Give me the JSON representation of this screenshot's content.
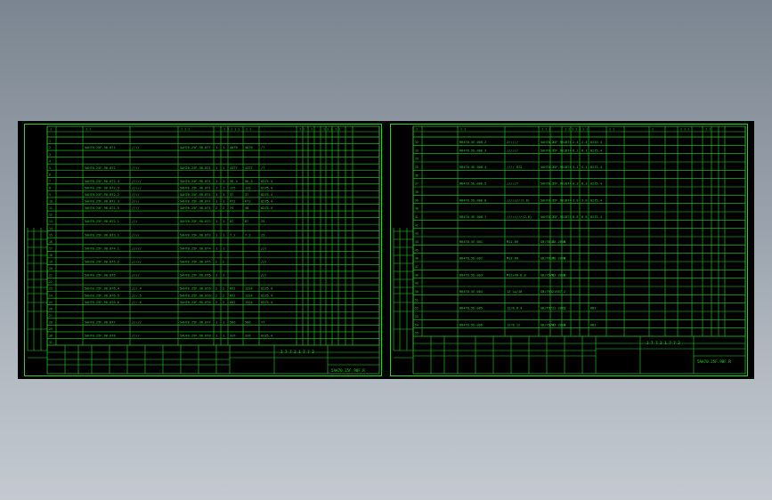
{
  "background": {
    "top_color": "#7b8590",
    "bottom_color": "#c4c9d0"
  },
  "line_color": "#22d622",
  "text_color": "#22d622",
  "sheets": [
    {
      "id": "left",
      "title_block_label": "1 7 7 2 1 7 7 2",
      "drawing_code": "5AH70.25F.98F.R",
      "row_numbers": [
        "1",
        "2",
        "3",
        "4",
        "5",
        "6",
        "7",
        "8",
        "9",
        "10",
        "11",
        "12",
        "13",
        "14",
        "15",
        "16",
        "17",
        "18",
        "19",
        "20",
        "21",
        "22",
        "23",
        "24",
        "25",
        "26",
        "27",
        "28",
        "29",
        "30",
        "31"
      ],
      "rows": [
        {
          "n": "1",
          "code": "",
          "name": "",
          "std": "",
          "q1": "",
          "q2": "",
          "w1": "",
          "w2": "",
          "note": ""
        },
        {
          "n": "2",
          "code": "5AH70.25F.98.871",
          "name": "////",
          "std": "5AH70.25F.98.877",
          "q1": "1",
          "q2": "1",
          "w1": "4870",
          "w2": "4870",
          "note": "/7"
        },
        {
          "n": "3",
          "code": "",
          "name": "",
          "std": "",
          "q1": "",
          "q2": "",
          "w1": "",
          "w2": "",
          "note": ""
        },
        {
          "n": "4",
          "code": "",
          "name": "",
          "std": "",
          "q1": "",
          "q2": "",
          "w1": "",
          "w2": "",
          "note": ""
        },
        {
          "n": "5",
          "code": "5AH70.25F.98.872",
          "name": "////",
          "std": "5AH70.25F.98.871",
          "q1": "1",
          "q2": "1",
          "w1": "4377",
          "w2": "4377",
          "note": "/7"
        },
        {
          "n": "6",
          "code": "",
          "name": "",
          "std": "",
          "q1": "",
          "q2": "",
          "w1": "",
          "w2": "",
          "note": ""
        },
        {
          "n": "7",
          "code": "5AH70.25F.98.872.4",
          "name": "/////",
          "std": "5AH70.25F.98.871",
          "q1": "1",
          "q2": "1",
          "w1": "56.3",
          "w2": "56.3",
          "note": "02Z5.4"
        },
        {
          "n": "8",
          "code": "5AH70.25F.98.872.5",
          "name": "/////",
          "std": "5AH70.25F.98.871",
          "q1": "1",
          "q2": "1",
          "w1": "125",
          "w2": "125",
          "note": "02Z5.4"
        },
        {
          "n": "9",
          "code": "5AH70.25F.98.872.2",
          "name": "////",
          "std": "5AH70.25F.98.871",
          "q1": "1",
          "q2": "1",
          "w1": "37",
          "w2": "37",
          "note": "02Z5.4"
        },
        {
          "n": "10",
          "code": "5AH70.25F.98.872.3",
          "name": "////",
          "std": "5AH70.25F.98.871",
          "q1": "1",
          "q2": "1",
          "w1": "672",
          "w2": "672",
          "note": "02Z5.4"
        },
        {
          "n": "11",
          "code": "5AH70.25F.98.872.5",
          "name": "////",
          "std": "5AH70.25F.98.871",
          "q1": "2",
          "q2": "2",
          "w1": "24",
          "w2": "48",
          "note": "02Z5.4"
        },
        {
          "n": "12",
          "code": "",
          "name": "",
          "std": "",
          "q1": "",
          "q2": "",
          "w1": "",
          "w2": "",
          "note": ""
        },
        {
          "n": "13",
          "code": "5AH70.25F.98.872.1",
          "name": "///",
          "std": "5AH70.25F.98.872",
          "q1": "1",
          "q2": "1",
          "w1": "87",
          "w2": "87",
          "note": "25"
        },
        {
          "n": "14",
          "code": "",
          "name": "",
          "std": "",
          "q1": "",
          "q2": "",
          "w1": "",
          "w2": "",
          "note": ""
        },
        {
          "n": "15",
          "code": "5AH70.25F.98.873.1",
          "name": "////",
          "std": "5AH70.25F.98.873",
          "q1": "1",
          "q2": "1",
          "w1": "7.2",
          "w2": "7.2",
          "note": "25"
        },
        {
          "n": "16",
          "code": "",
          "name": "",
          "std": "",
          "q1": "",
          "q2": "",
          "w1": "",
          "w2": "",
          "note": ""
        },
        {
          "n": "17",
          "code": "5AH70.25F.98.874.1",
          "name": "/////",
          "std": "5AH70.25F.98.874",
          "q1": "1",
          "q2": "1",
          "w1": "",
          "w2": "",
          "note": "///"
        },
        {
          "n": "18",
          "code": "",
          "name": "",
          "std": "",
          "q1": "",
          "q2": "",
          "w1": "",
          "w2": "",
          "note": ""
        },
        {
          "n": "19",
          "code": "5AH70.25F.98.875.2",
          "name": "/////",
          "std": "5AH70.25F.98.875",
          "q1": "2",
          "q2": "2",
          "w1": "",
          "w2": "",
          "note": "///"
        },
        {
          "n": "20",
          "code": "",
          "name": "",
          "std": "",
          "q1": "",
          "q2": "",
          "w1": "",
          "w2": "",
          "note": ""
        },
        {
          "n": "21",
          "code": "5AH70.25F.98.876",
          "name": "////",
          "std": "5AH70.25F.98.875",
          "q1": "1",
          "q2": "1",
          "w1": "",
          "w2": "",
          "note": "///"
        },
        {
          "n": "22",
          "code": "",
          "name": "",
          "std": "",
          "q1": "",
          "q2": "",
          "w1": "",
          "w2": "",
          "note": ""
        },
        {
          "n": "23",
          "code": "5AH70.25F.98.876.4",
          "name": "///.4",
          "std": "5AH70.25F.98.876",
          "q1": "2",
          "q2": "2",
          "w1": "662",
          "w2": "1324",
          "note": "02Z5.4"
        },
        {
          "n": "24",
          "code": "5AH70.25F.98.876.5",
          "name": "///.5",
          "std": "5AH70.25F.98.876",
          "q1": "2",
          "q2": "2",
          "w1": "662",
          "w2": "1324",
          "note": "02Z5.4"
        },
        {
          "n": "25",
          "code": "5AH70.25F.98.876.6",
          "name": "///.6",
          "std": "5AH70.25F.98.876",
          "q1": "2",
          "q2": "2",
          "w1": "662",
          "w2": "1324",
          "note": "02Z5.4"
        },
        {
          "n": "26",
          "code": "",
          "name": "",
          "std": "",
          "q1": "",
          "q2": "",
          "w1": "",
          "w2": "",
          "note": ""
        },
        {
          "n": "27",
          "code": "",
          "name": "",
          "std": "",
          "q1": "",
          "q2": "",
          "w1": "",
          "w2": "",
          "note": ""
        },
        {
          "n": "28",
          "code": "5AH70.25F.98.877",
          "name": "/////",
          "std": "5AH70.25F.98.877",
          "q1": "1",
          "q2": "1",
          "w1": "566",
          "w2": "566",
          "note": "77"
        },
        {
          "n": "29",
          "code": "",
          "name": "",
          "std": "",
          "q1": "",
          "q2": "",
          "w1": "",
          "w2": "",
          "note": ""
        },
        {
          "n": "30",
          "code": "5AH70.25F.98.878",
          "name": "////",
          "std": "5AH70.25F.98.878",
          "q1": "1",
          "q2": "1",
          "w1": "326",
          "w2": "326",
          "note": "02Z5.4"
        },
        {
          "n": "31",
          "code": "",
          "name": "",
          "std": "",
          "q1": "",
          "q2": "",
          "w1": "",
          "w2": "",
          "note": ""
        }
      ]
    },
    {
      "id": "right",
      "title_block_label": "1 7 7 2 1 7 7 2",
      "drawing_code": "5AH70.25F.98F.R",
      "rows": [
        {
          "n": "32",
          "code": "HB470.5E.000.2",
          "name": "2/////",
          "std": "5AH70.25F.98.874",
          "q1": "1",
          "q2": "1",
          "w1": "2.4",
          "w2": "2.4",
          "note": "02Z5.4"
        },
        {
          "n": "33",
          "code": "HB470.5E.000.3",
          "name": "//////",
          "std": "5AH70.25F.98.874",
          "q1": "1",
          "q2": "1",
          "w1": "8.1",
          "w2": "8.1",
          "note": "02Z5.4"
        },
        {
          "n": "34",
          "code": "",
          "name": "",
          "std": "",
          "q1": "",
          "q2": "",
          "w1": "",
          "w2": "",
          "note": ""
        },
        {
          "n": "35",
          "code": "HB470.5E.000.4",
          "name": "//// 872",
          "std": "5AH70.25F.98.874",
          "q1": "1",
          "q2": "1",
          "w1": "4.1",
          "w2": "4.1",
          "note": "02Z5.4"
        },
        {
          "n": "36",
          "code": "",
          "name": "",
          "std": "",
          "q1": "",
          "q2": "",
          "w1": "",
          "w2": "",
          "note": ""
        },
        {
          "n": "37",
          "code": "HB470.5E.000.5",
          "name": "/////7",
          "std": "5AH70.25F.98.874",
          "q1": "1",
          "q2": "1",
          "w1": "8.3",
          "w2": "8.3",
          "note": "02Z5.4"
        },
        {
          "n": "38",
          "code": "",
          "name": "",
          "std": "",
          "q1": "",
          "q2": "",
          "w1": "",
          "w2": "",
          "note": ""
        },
        {
          "n": "39",
          "code": "HB470.5E.000.6",
          "name": "///////(2.8)",
          "std": "5AH70.25F.98.874",
          "q1": "1",
          "q2": "1",
          "w1": "3.8",
          "w2": "3.8",
          "note": "02Z5.4"
        },
        {
          "n": "40",
          "code": "",
          "name": "",
          "std": "",
          "q1": "",
          "q2": "",
          "w1": "",
          "w2": "",
          "note": ""
        },
        {
          "n": "41",
          "code": "HB470.5E.000.7",
          "name": "////////(2.8)",
          "std": "5AH70.25F.98.874",
          "q1": "1",
          "q2": "1",
          "w1": "8.8",
          "w2": "8.8",
          "note": "02Z5.4"
        },
        {
          "n": "42",
          "code": "",
          "name": "",
          "std": "",
          "q1": "",
          "q2": "",
          "w1": "",
          "w2": "",
          "note": ""
        },
        {
          "n": "43",
          "code": "",
          "name": "",
          "std": "",
          "q1": "",
          "q2": "",
          "w1": "",
          "w2": "",
          "note": ""
        },
        {
          "n": "44",
          "code": "HB470.5E.001",
          "name": "M12-8H",
          "std": "GB/T6170-2000",
          "q1": "8",
          "q2": "8",
          "w1": "",
          "w2": "",
          "note": ""
        },
        {
          "n": "45",
          "code": "",
          "name": "",
          "std": "",
          "q1": "",
          "q2": "",
          "w1": "",
          "w2": "",
          "note": ""
        },
        {
          "n": "46",
          "code": "HB470.5E.002",
          "name": "M12-8H",
          "std": "GB/T6170-2000",
          "q1": "6",
          "q2": "6",
          "w1": "",
          "w2": "",
          "note": ""
        },
        {
          "n": "47",
          "code": "",
          "name": "",
          "std": "",
          "q1": "",
          "q2": "",
          "w1": "",
          "w2": "",
          "note": ""
        },
        {
          "n": "48",
          "code": "HB470.5E.003",
          "name": "M12x40-8.8",
          "std": "GB/T5783-2000",
          "q1": "8",
          "q2": "8",
          "w1": "",
          "w2": "",
          "note": ""
        },
        {
          "n": "49",
          "code": "",
          "name": "",
          "std": "",
          "q1": "",
          "q2": "",
          "w1": "",
          "w2": "",
          "note": ""
        },
        {
          "n": "50",
          "code": "HB470.5E.004",
          "name": "12 Lw/10",
          "std": "GB/T93-1987",
          "q1": "2",
          "q2": "2",
          "w1": "",
          "w2": "",
          "note": ""
        },
        {
          "n": "51",
          "code": "",
          "name": "",
          "std": "",
          "q1": "",
          "q2": "",
          "w1": "",
          "w2": "",
          "note": ""
        },
        {
          "n": "52",
          "code": "HB470.5E.005",
          "name": "12/8.8.4",
          "std": "GB/T97.1-2002",
          "q1": "2",
          "q2": "2",
          "w1": "",
          "w2": "",
          "note": "HB2"
        },
        {
          "n": "53",
          "code": "",
          "name": "",
          "std": "",
          "q1": "",
          "q2": "",
          "w1": "",
          "w2": "",
          "note": ""
        },
        {
          "n": "54",
          "code": "HB470.5E.006",
          "name": "12/8.12",
          "std": "GB/T5783-2000",
          "q1": "4",
          "q2": "4",
          "w1": "",
          "w2": "",
          "note": "HB2"
        },
        {
          "n": "55",
          "code": "",
          "name": "",
          "std": "",
          "q1": "",
          "q2": "",
          "w1": "",
          "w2": "",
          "note": ""
        }
      ]
    }
  ]
}
